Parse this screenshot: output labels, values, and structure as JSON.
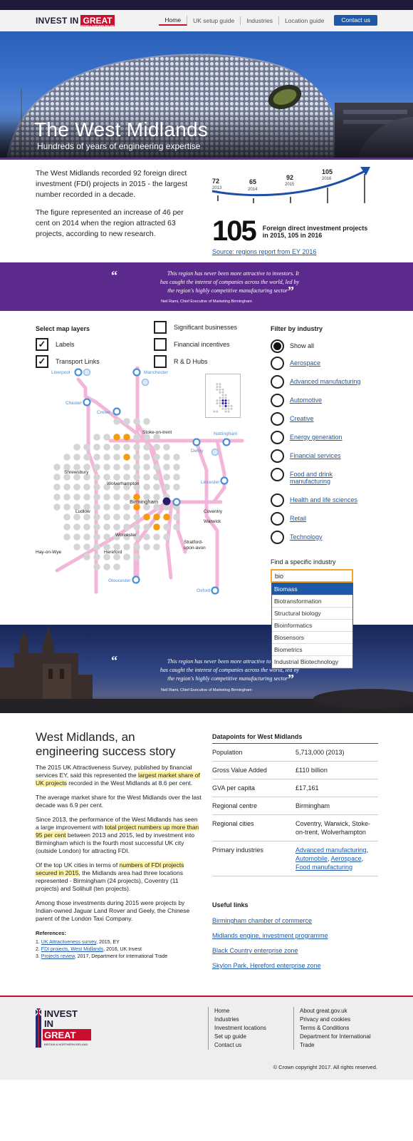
{
  "header": {
    "logo": {
      "word1": "INVEST IN",
      "word2": "GREAT",
      "sub": "BRITAIN & NORTHERN IRELAND"
    },
    "nav": [
      "Home",
      "UK setup guide",
      "Industries",
      "Location guide"
    ],
    "contact_label": "Contact us"
  },
  "hero": {
    "title": "The West Midlands",
    "subtitle": "Hundreds of years of engineering expertise"
  },
  "intro": {
    "p1": "The West Midlands recorded 92 foreign direct investment (FDI) projects in 2015 - the largest number recorded in a decade.",
    "p2": "The figure represented an increase of 46 per cent on 2014 when the region attracted 63 projects, according to new research."
  },
  "timeline": {
    "points": [
      {
        "value": "72",
        "year": "2013"
      },
      {
        "value": "65",
        "year": "2014"
      },
      {
        "value": "92",
        "year": "2015"
      },
      {
        "value": "105",
        "year": "2016"
      }
    ]
  },
  "stat": {
    "number": "105",
    "text": "Foreign direct investment projects in 2015, 105 in 2016",
    "source": "Source: regions report from EY 2016"
  },
  "quote": {
    "line1": "This region has never been more attractive to investors. It",
    "line2": "has caught the interest of companies across the world, led by",
    "line3": "the region's highly competitive manufacturing sector",
    "attribution": "Neil Rami, Chief Executive of Marketing Birmingham"
  },
  "map_layers": {
    "title": "Select map layers",
    "items": [
      {
        "label": "Labels",
        "checked": true
      },
      {
        "label": "Transport Links",
        "checked": true
      },
      {
        "label": "Significant businesses",
        "checked": false
      },
      {
        "label": "Financial incentives",
        "checked": false
      },
      {
        "label": "R & D Hubs",
        "checked": false
      }
    ]
  },
  "map": {
    "places": {
      "liverpool": "Liverpool",
      "manchester": "Manchester",
      "chester": "Chester",
      "crewe": "Crewe",
      "stoke": "Stoke-on-trent",
      "nottingham": "Nottingham",
      "derby": "Derby",
      "shrewsbury": "Shrewsbury",
      "wolverhampton": "Wolverhampton",
      "leicester": "Leicester",
      "birmingham": "Birmingham",
      "ludlow": "Ludlow",
      "coventry": "Coventry",
      "warwick": "Warwick",
      "worcester": "Worcester",
      "stratford1": "Stratford-",
      "stratford2": "upon-avon",
      "hay": "Hay-on-Wye",
      "hereford": "Hereford",
      "gloucester": "Gloucester",
      "oxford": "Oxford"
    },
    "colors": {
      "route": "#f4b6d8",
      "dot": "#d5d5d5",
      "highlight": "#f39c12",
      "station": "#4a90d9",
      "city": "#2a1a6e"
    }
  },
  "filter": {
    "title": "Filter by industry",
    "items": [
      {
        "label": "Show all",
        "selected": true
      },
      {
        "label": "Aerospace",
        "selected": false
      },
      {
        "label": "Advanced manufacturing",
        "selected": false
      },
      {
        "label": "Automotive",
        "selected": false
      },
      {
        "label": "Creative",
        "selected": false
      },
      {
        "label": "Energy generation",
        "selected": false
      },
      {
        "label": "Financial services",
        "selected": false
      },
      {
        "label": "Food and drink manufacturing",
        "selected": false
      },
      {
        "label": "Health and life sciences",
        "selected": false
      },
      {
        "label": "Retail",
        "selected": false
      },
      {
        "label": "Technology",
        "selected": false
      }
    ]
  },
  "find": {
    "title": "Find a specific industry",
    "value": "bio",
    "options": [
      "Biomass",
      "Biotransformation",
      "Structural biology",
      "Bioinformatics",
      "Biosensors",
      "Biometrics",
      "Industrial Biotechnology"
    ]
  },
  "article": {
    "title": "West Midlands, an engineering success story",
    "p1a": "The 2015 UK Attractiveness Survey, published by financial services EY, said this represented the ",
    "p1h": "largest market share of UK projects",
    "p1b": " recorded in the West Midlands at 8.6 per cent.",
    "p2": "The average market share for the West Midlands over the last decade was 6.9 per cent.",
    "p3a": "Since 2013, the performance of the West Midlands has seen a large improvement with ",
    "p3h": "total project numbers up more than 95 per cent",
    "p3b": " between 2013 and 2015, led by investment into Birmingham which is the fourth most successful UK city (outside London) for attracting FDI.",
    "p4a": "Of the top UK cities in terms of ",
    "p4h": "numbers of FDI projects secured in 2015",
    "p4b": ", the Midlands area had three locations represented - Birmingham (24 projects), Coventry (11 projects) and Solihull (ten projects).",
    "p5": "Among those investments during 2015 were projects by Indian-owned Jaguar Land Rover and Geely, the Chinese parent of the London Taxi Company.",
    "refs_title": "References:",
    "refs": [
      {
        "num": "1. ",
        "link": "UK Attractiveness survey",
        "rest": ", 2015, EY"
      },
      {
        "num": "2. ",
        "link": "FDI projects, West Midlands",
        "rest": ", 2016, UK Invest"
      },
      {
        "num": "3. ",
        "link": "Projects review",
        "rest": ", 2017, Department for International Trade"
      }
    ]
  },
  "datapoints": {
    "title": "Datapoints for West Midlands",
    "rows": [
      {
        "k": "Population",
        "v": "5,713,000 (2013)"
      },
      {
        "k": "Gross Value Added",
        "v": "£110 billion"
      },
      {
        "k": "GVA per capita",
        "v": "£17,161"
      },
      {
        "k": "Regional centre",
        "v": "Birmingham"
      },
      {
        "k": "Regional cities",
        "v": "Coventry, Warwick, Stoke-on-trent, Wolverhampton"
      }
    ],
    "industries_label": "Primary industries",
    "industries": [
      "Advanced manufacturing",
      "Automobile",
      "Aerospace",
      "Food manufacturing"
    ]
  },
  "useful": {
    "title": "Useful links",
    "links": [
      "Birmingham chamber of commerce",
      "Midlands engine, investment programme",
      "Black Country enterprise zone",
      "Skylon Park, Hereford enterprise zone"
    ]
  },
  "footer": {
    "logo": {
      "w1": "INVEST",
      "w2": "IN",
      "w3": "GREAT",
      "sub": "BRITAIN & NORTHERN IRELAND"
    },
    "col1": [
      "Home",
      "Industries",
      "Investment locations",
      "Set up guide",
      "Contact us"
    ],
    "col2": [
      "About great.gov.uk",
      "Privacy and cookies",
      "Terms & Conditions",
      "Department for International Trade"
    ],
    "copyright": "© Crown copyright 2017. All rights reserved."
  }
}
